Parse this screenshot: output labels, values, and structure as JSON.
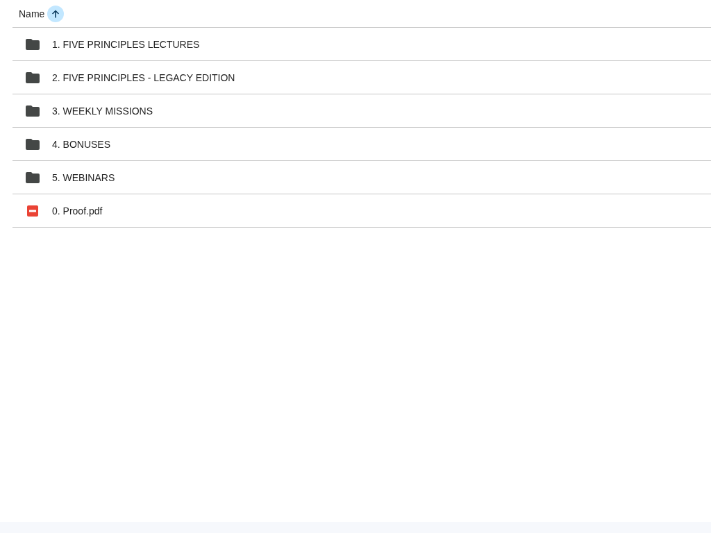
{
  "header": {
    "label": "Name",
    "sort_ascending": true
  },
  "files": [
    {
      "name": "1. FIVE PRINCIPLES LECTURES",
      "kind": "folder"
    },
    {
      "name": "2. FIVE PRINCIPLES - LEGACY EDITION",
      "kind": "folder"
    },
    {
      "name": "3. WEEKLY MISSIONS",
      "kind": "folder"
    },
    {
      "name": "4. BONUSES",
      "kind": "folder"
    },
    {
      "name": "5. WEBINARS",
      "kind": "folder"
    },
    {
      "name": "0. Proof.pdf",
      "kind": "pdf"
    }
  ]
}
